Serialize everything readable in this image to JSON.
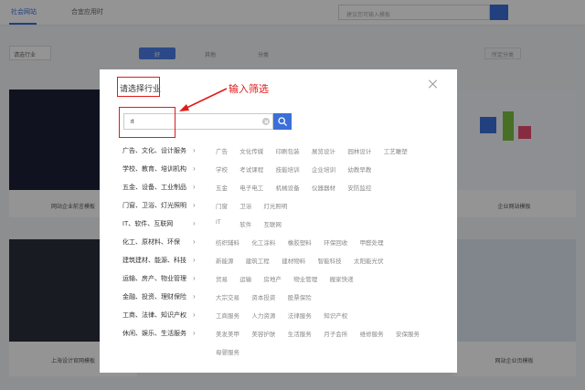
{
  "background": {
    "tabs": [
      "社会网站",
      "合宜应用时"
    ],
    "search_placeholder": "建议您可输入模板",
    "filter_select": "请选行业",
    "filter_pills": [
      "好",
      "其他",
      "分类"
    ],
    "filter_right": "所定分类",
    "card_captions": [
      "网站企业前言模板",
      "企业网站模板",
      "上海设计官网模板",
      "网站企业页模板"
    ]
  },
  "modal": {
    "title": "请选择行业",
    "search": {
      "value": "it",
      "placeholder": ""
    },
    "categories": [
      {
        "name": "广告、文化、设计服务",
        "subs": [
          "广告",
          "文化传媒",
          "印刷包装",
          "展览设计",
          "园林设计",
          "工艺雕塑"
        ]
      },
      {
        "name": "学校、教育、培训机构",
        "subs": [
          "学校",
          "考试课程",
          "技能培训",
          "企业培训",
          "幼教早教"
        ]
      },
      {
        "name": "五金、设备、工业制品",
        "subs": [
          "五金",
          "电子电工",
          "机械设备",
          "仪器器材",
          "安防监控"
        ]
      },
      {
        "name": "门窗、卫浴、灯光照明",
        "subs": [
          "门窗",
          "卫浴",
          "灯光照明"
        ]
      },
      {
        "name": "IT、软件、互联网",
        "subs": [
          "IT",
          "软件",
          "互联网"
        ]
      },
      {
        "name": "化工、原材料、环保",
        "subs": [
          "纺织辅料",
          "化工涂料",
          "橡胶塑料",
          "环保回收",
          "甲醛处理"
        ]
      },
      {
        "name": "建筑建材、能源、科技",
        "subs": [
          "新能源",
          "建筑工程",
          "建材物料",
          "智能科技",
          "太阳能光伏"
        ]
      },
      {
        "name": "运输、房产、物业管理",
        "subs": [
          "贸易",
          "运输",
          "房地产",
          "物业管理",
          "搬家快递"
        ]
      },
      {
        "name": "金融、投资、理财保险",
        "subs": [
          "大宗交易",
          "资本投资",
          "股票保险"
        ]
      },
      {
        "name": "工商、法律、知识产权",
        "subs": [
          "工商服务",
          "人力资源",
          "法律服务",
          "知识产权"
        ]
      },
      {
        "name": "休闲、娱乐、生活服务",
        "subs": [
          "美发美甲",
          "美容护肤",
          "生活服务",
          "月子会所",
          "维修服务",
          "安保服务",
          "母婴服务"
        ]
      }
    ]
  },
  "annotation": {
    "text": "输入筛选"
  },
  "colors": {
    "accent": "#3a6fd8",
    "annotation": "#e01b1b"
  }
}
